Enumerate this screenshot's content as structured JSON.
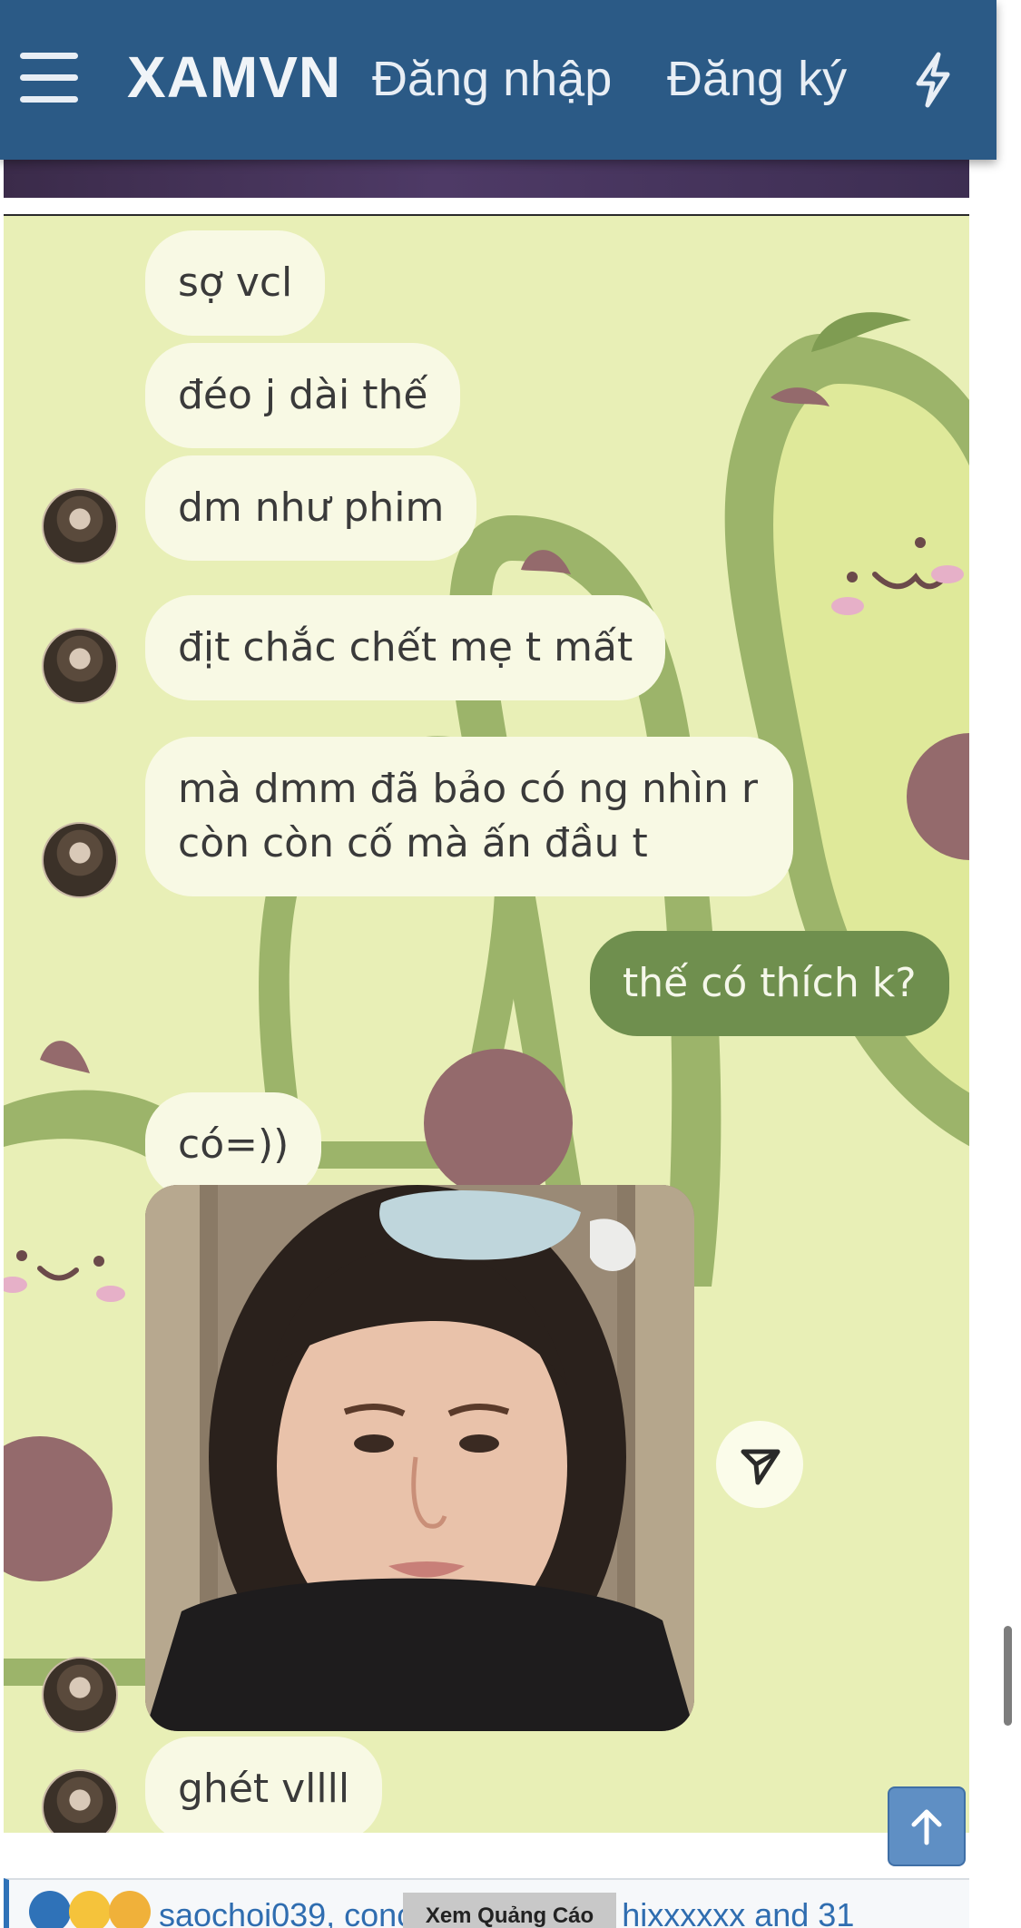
{
  "header": {
    "menu_icon": "hamburger-icon",
    "brand": "XAMVN",
    "login": "Đăng nhập",
    "register": "Đăng ký",
    "whats_new_icon": "bolt-icon",
    "background": "#2b5a86"
  },
  "chat": {
    "background": "#e8efb6",
    "messages": [
      {
        "text": "sợ vcl",
        "from": "other"
      },
      {
        "text": "đéo j dài thế",
        "from": "other"
      },
      {
        "text": "dm như phim",
        "from": "other"
      },
      {
        "text": "địt chắc chết mẹ t mất",
        "from": "other"
      },
      {
        "text": "mà dmm đã bảo có ng nhìn r\ncòn còn cố mà ấn đầu t",
        "from": "other"
      },
      {
        "text": "thế có thích k?",
        "from": "me"
      },
      {
        "text": "có=))",
        "from": "other"
      },
      {
        "text": "ghét vllll",
        "from": "other"
      }
    ],
    "photo": "selfie-photo",
    "share_icon": "send-icon"
  },
  "back_to_top_icon": "arrow-up-icon",
  "reactions": {
    "icons": [
      "like-icon",
      "haha-icon",
      "love-icon"
    ],
    "text": "saochoi039, conc",
    "text_tail": "hixxxxxx and 31",
    "ad_label": "Xem Quảng Cáo"
  }
}
